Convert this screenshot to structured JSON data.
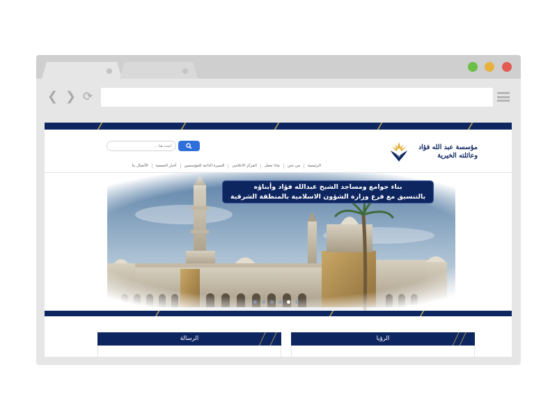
{
  "browser": {
    "tabs": [
      {
        "label": ""
      },
      {
        "label": ""
      }
    ],
    "address": "",
    "icons": [
      "back-arrow-icon",
      "forward-arrow-icon",
      "reload-icon",
      "hamburger-menu-icon"
    ],
    "window_buttons": [
      "green",
      "yellow",
      "red"
    ]
  },
  "site": {
    "logo_text_line1": "مؤسسة عبد الله فؤاد",
    "logo_text_line2": "وعائلته الخيرية",
    "search": {
      "placeholder": "ابحث هنا ..."
    },
    "nav": [
      "الرئيسية",
      "من نحن",
      "ماذا نعمل",
      "المركز الاعلامي",
      "السيرة الذاتية للمؤسسين",
      "أخبار الجمعية",
      "الأتصال بنا"
    ],
    "hero": {
      "caption_line1": "بناء جوامع ومساجد الشيخ عبدالله فؤاد وأبناؤه",
      "caption_line2": "بالتنسيق مع فرع وزارة الشؤون الاسلامية بالمنطقة الشرقية",
      "slides": 6,
      "active_slide": 4
    },
    "cards": {
      "vision": "الرؤيا",
      "mission": "الرسالة"
    },
    "colors": {
      "navy": "#0e2660",
      "gold": "#b09a5a",
      "search_blue": "#2f6fdc"
    }
  }
}
